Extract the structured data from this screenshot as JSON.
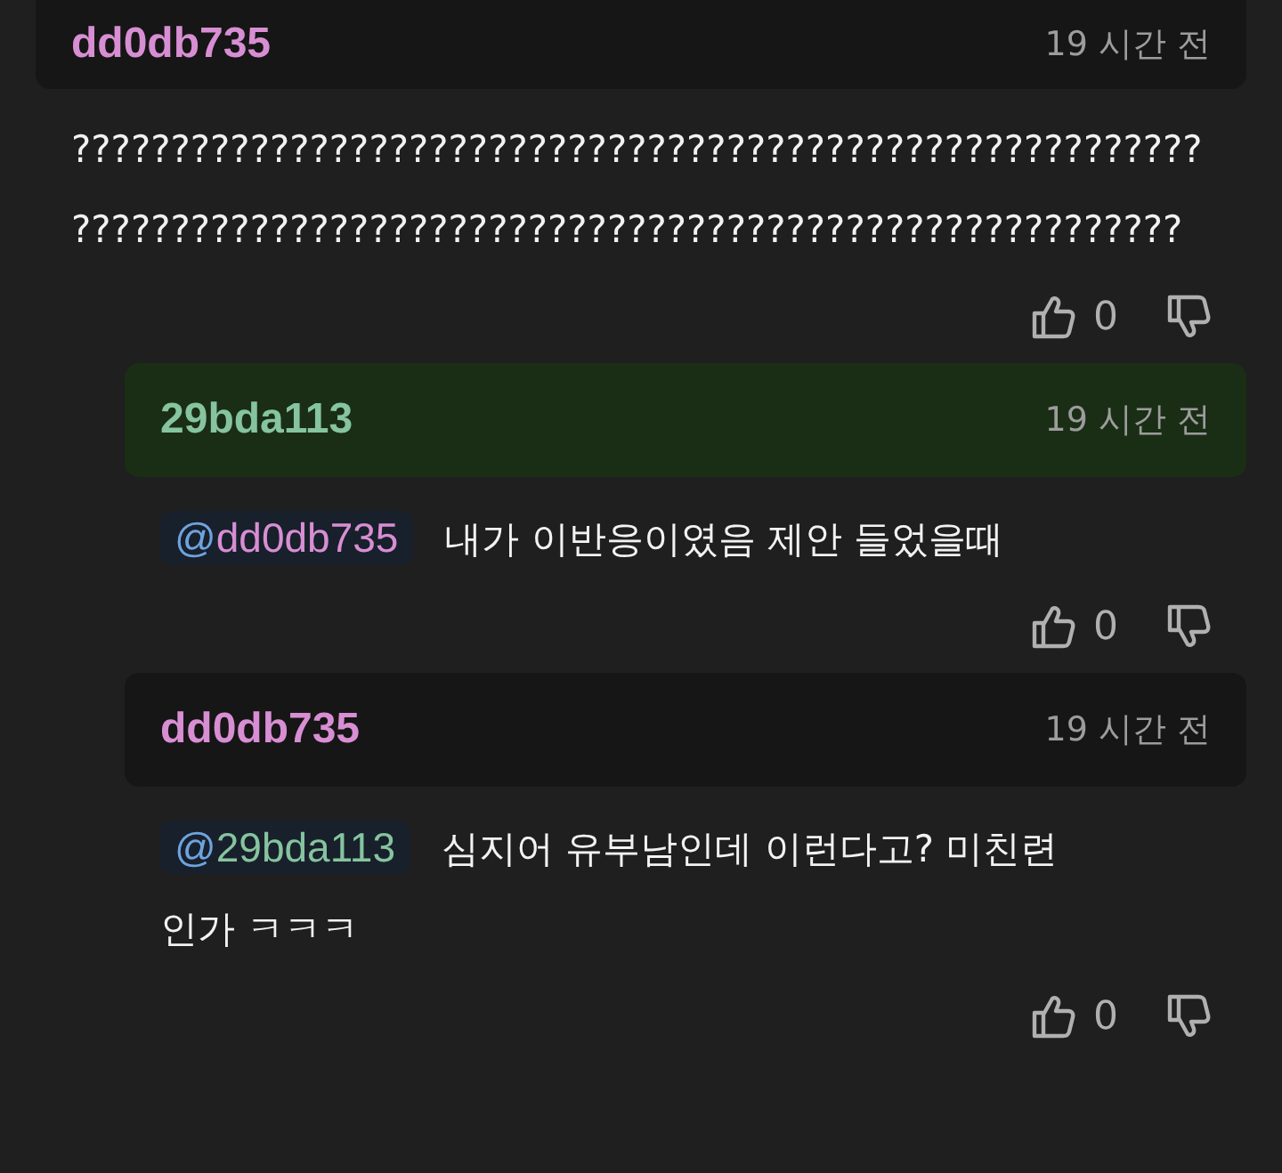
{
  "comments": [
    {
      "author": "dd0db735",
      "color": "#d88ed3",
      "time": "19 시간 전",
      "highlighted": false,
      "text": "?????????????????????????????????????????????????????????????????????????????????????????????????????????????????",
      "likes": "0",
      "children": [
        {
          "author": "29bda113",
          "color": "#86c4a0",
          "time": "19 시간 전",
          "highlighted": true,
          "mention": {
            "at": "@",
            "name": "dd0db735",
            "color": "#d88ed3"
          },
          "lines": [
            "내가 이반응이였음 제안 들었을때"
          ],
          "likes": "0"
        },
        {
          "author": "dd0db735",
          "color": "#d88ed3",
          "time": "19 시간 전",
          "highlighted": false,
          "mention": {
            "at": "@",
            "name": "29bda113",
            "color": "#86c4a0"
          },
          "lines": [
            "심지어 유부남인데 이런다고? 미친련",
            "인가 ㅋㅋㅋ"
          ],
          "likes": "0"
        }
      ]
    }
  ]
}
